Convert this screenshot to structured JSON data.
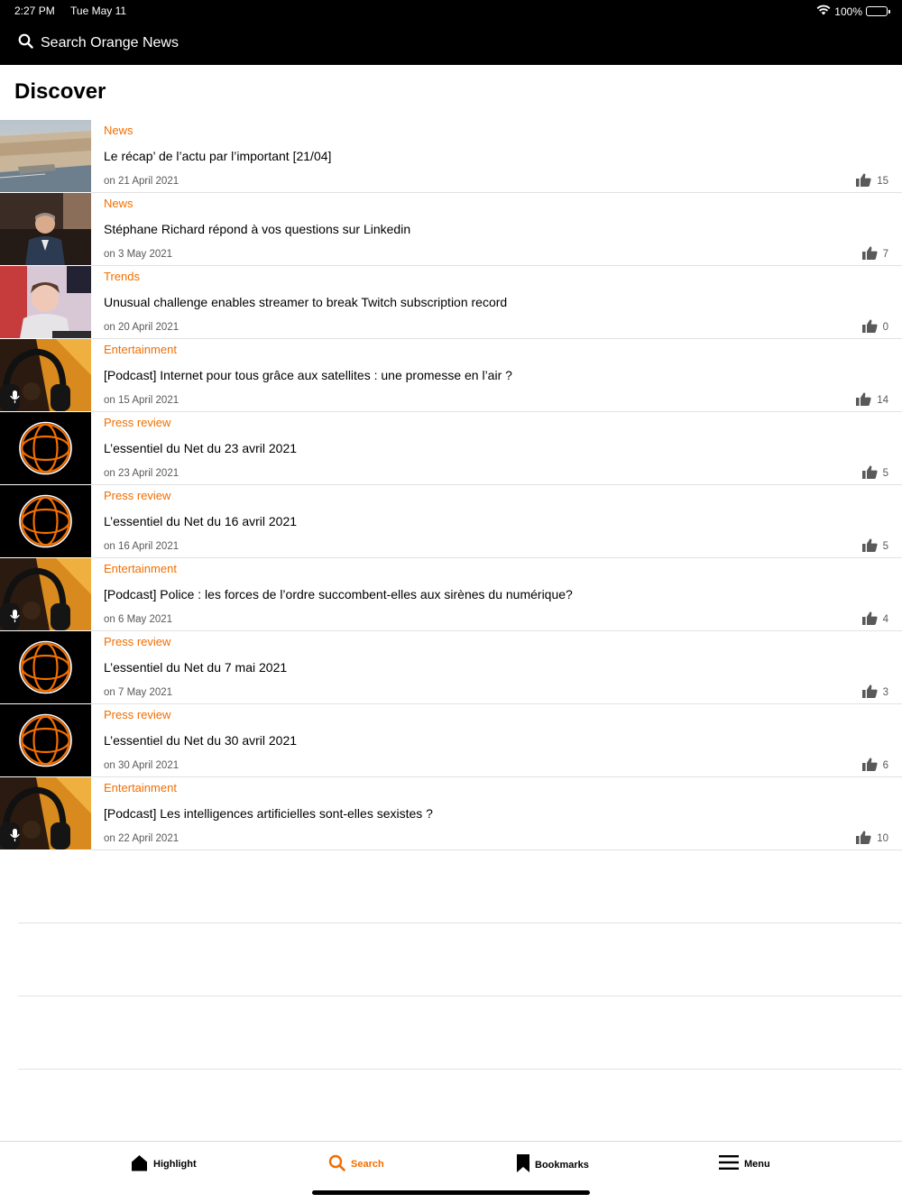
{
  "status_bar": {
    "time": "2:27 PM",
    "date": "Tue May 11",
    "battery": "100%"
  },
  "search": {
    "placeholder": "Search Orange News"
  },
  "page": {
    "title": "Discover"
  },
  "colors": {
    "accent": "#f16e00",
    "header_bg": "#000000",
    "meta_text": "#595959"
  },
  "articles": [
    {
      "category": "News",
      "title": "Le récap’ de l’actu par l’important [21/04]",
      "date": "on 21 April 2021",
      "likes": "15",
      "thumbnail": "harbor-aerial"
    },
    {
      "category": "News",
      "title": "Stéphane Richard répond à vos questions sur Linkedin",
      "date": "on 3 May 2021",
      "likes": "7",
      "thumbnail": "ceo-portrait"
    },
    {
      "category": "Trends",
      "title": "Unusual challenge enables streamer to break Twitch subscription record",
      "date": "on 20 April 2021",
      "likes": "0",
      "thumbnail": "streamer-portrait"
    },
    {
      "category": "Entertainment",
      "title": "[Podcast] Internet pour tous grâce aux satellites : une promesse en l’air ?",
      "date": "on 15 April 2021",
      "likes": "14",
      "thumbnail": "podcast-headphones"
    },
    {
      "category": "Press review",
      "title": "L’essentiel du Net du 23 avril 2021",
      "date": "on 23 April 2021",
      "likes": "5",
      "thumbnail": "globe-logo"
    },
    {
      "category": "Press review",
      "title": "L’essentiel du Net du 16 avril 2021",
      "date": "on 16 April 2021",
      "likes": "5",
      "thumbnail": "globe-logo"
    },
    {
      "category": "Entertainment",
      "title": "[Podcast] Police : les forces de l’ordre succombent-elles aux sirènes du numérique?",
      "date": "on 6 May 2021",
      "likes": "4",
      "thumbnail": "podcast-headphones"
    },
    {
      "category": "Press review",
      "title": "L’essentiel du Net du 7 mai 2021",
      "date": "on 7 May 2021",
      "likes": "3",
      "thumbnail": "globe-logo"
    },
    {
      "category": "Press review",
      "title": "L’essentiel du Net du 30 avril 2021",
      "date": "on 30 April 2021",
      "likes": "6",
      "thumbnail": "globe-logo"
    },
    {
      "category": "Entertainment",
      "title": "[Podcast] Les intelligences artificielles sont-elles sexistes ?",
      "date": "on 22 April 2021",
      "likes": "10",
      "thumbnail": "podcast-headphones"
    }
  ],
  "tabs": [
    {
      "label": "Highlight",
      "icon": "home-icon",
      "active": false
    },
    {
      "label": "Search",
      "icon": "search-icon",
      "active": true
    },
    {
      "label": "Bookmarks",
      "icon": "bookmark-icon",
      "active": false
    },
    {
      "label": "Menu",
      "icon": "menu-icon",
      "active": false
    }
  ]
}
